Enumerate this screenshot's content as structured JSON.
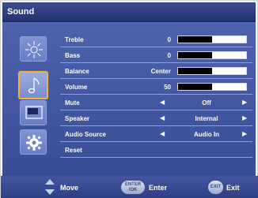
{
  "window": {
    "title": "Sound"
  },
  "sidebar": {
    "icons": [
      {
        "name": "picture-brightness-icon"
      },
      {
        "name": "sound-note-icon",
        "selected": true
      },
      {
        "name": "screen-display-icon"
      },
      {
        "name": "settings-gear-icon"
      }
    ]
  },
  "menu": {
    "treble": {
      "label": "Treble",
      "value": "0",
      "level": 0.5
    },
    "bass": {
      "label": "Bass",
      "value": "0",
      "level": 0.5
    },
    "balance": {
      "label": "Balance",
      "value": "Center",
      "level": 0.5
    },
    "volume": {
      "label": "Volume",
      "value": "50",
      "level": 0.5
    },
    "mute": {
      "label": "Mute",
      "value": "Off"
    },
    "speaker": {
      "label": "Speaker",
      "value": "Internal"
    },
    "audio_source": {
      "label": "Audio Source",
      "value": "Audio In"
    },
    "reset": {
      "label": "Reset"
    }
  },
  "footer": {
    "move_label": "Move",
    "enter_key": "ENTER\n/OK",
    "enter_label": "Enter",
    "exit_key": "EXIT",
    "exit_label": "Exit"
  },
  "colors": {
    "title_bar": "#2e3c7d",
    "panel": "#4a5ca6",
    "selected_border": "#f0b43a",
    "bar_fill": "#000000"
  }
}
